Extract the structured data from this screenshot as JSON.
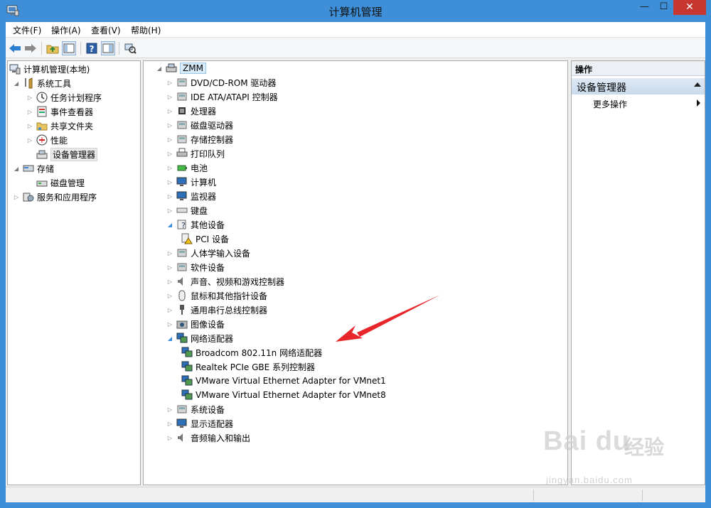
{
  "window": {
    "title": "计算机管理",
    "controls": {
      "minimize": "—",
      "maximize": "☐",
      "close": "✕"
    }
  },
  "menubar": {
    "items": [
      "文件(F)",
      "操作(A)",
      "查看(V)",
      "帮助(H)"
    ]
  },
  "toolbar": {
    "buttons": [
      "back-icon",
      "forward-icon",
      "up-folder-icon",
      "show-hide-tree-icon",
      "help-icon",
      "properties-icon",
      "scan-hardware-icon"
    ]
  },
  "left_tree": {
    "root": "计算机管理(本地)",
    "system_tools": "系统工具",
    "system_tools_children": [
      "任务计划程序",
      "事件查看器",
      "共享文件夹",
      "性能",
      "设备管理器"
    ],
    "storage": "存储",
    "storage_children": [
      "磁盘管理"
    ],
    "services": "服务和应用程序"
  },
  "device_tree": {
    "computer_name": "ZMM",
    "categories": [
      "DVD/CD-ROM 驱动器",
      "IDE ATA/ATAPI 控制器",
      "处理器",
      "磁盘驱动器",
      "存储控制器",
      "打印队列",
      "电池",
      "计算机",
      "监视器",
      "键盘",
      "其他设备",
      "PCI 设备",
      "人体学输入设备",
      "软件设备",
      "声音、视频和游戏控制器",
      "鼠标和其他指针设备",
      "通用串行总线控制器",
      "图像设备",
      "网络适配器",
      "Broadcom 802.11n 网络适配器",
      "Realtek PCIe GBE 系列控制器",
      "VMware Virtual Ethernet Adapter for VMnet1",
      "VMware Virtual Ethernet Adapter for VMnet8",
      "系统设备",
      "显示适配器",
      "音频输入和输出"
    ]
  },
  "actions_pane": {
    "header": "操作",
    "section": "设备管理器",
    "more": "更多操作"
  },
  "watermark": {
    "logo": "Bai du",
    "chinese": "经验",
    "url": "jingyan.baidu.com"
  },
  "colors": {
    "titlebar": "#3e8fd8",
    "close_button": "#c7372f",
    "annotation_arrow": "#e8262a",
    "selection": "#d9ebf9"
  }
}
